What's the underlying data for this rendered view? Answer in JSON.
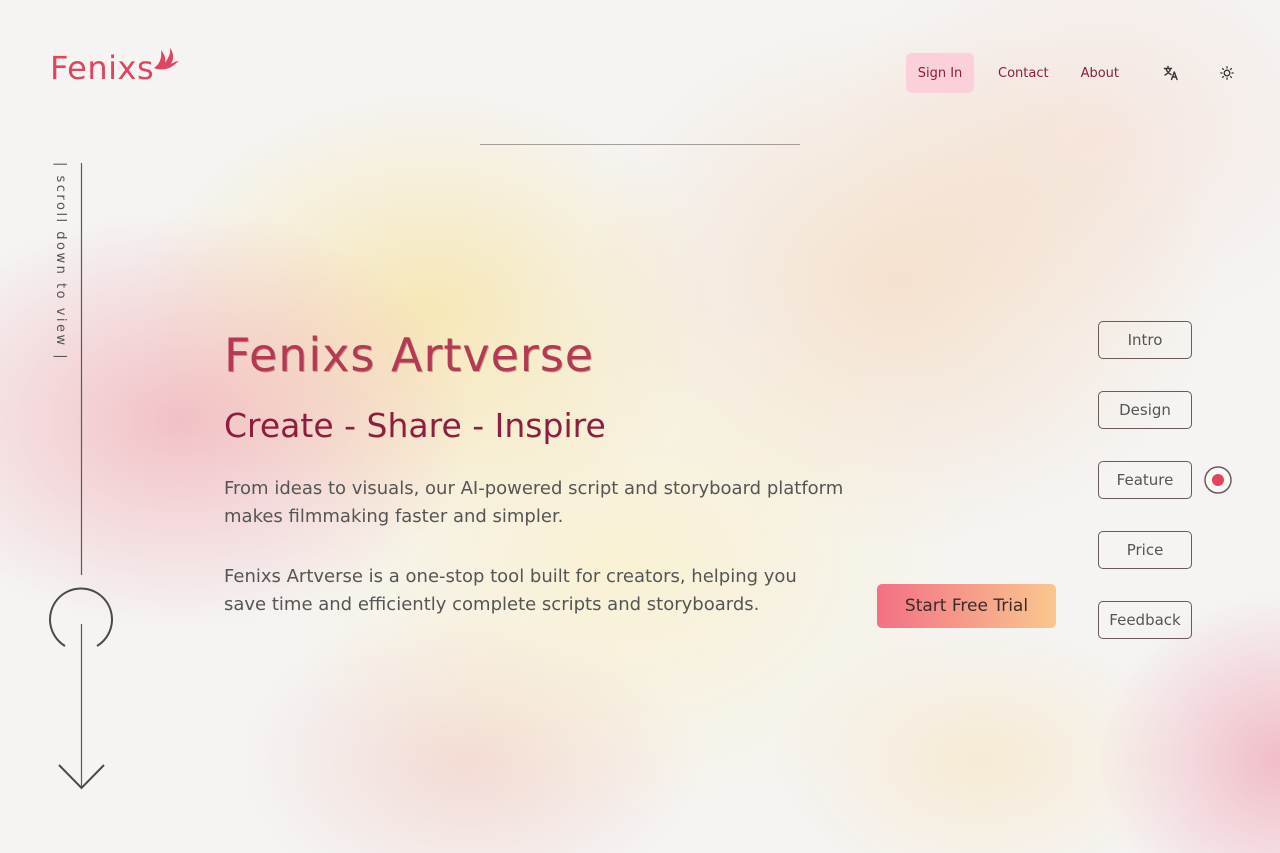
{
  "brand": {
    "name": "Fenixs",
    "color": "#e0455d",
    "mark_icon": "phoenix-flame-icon"
  },
  "header": {
    "nav": {
      "sign_in": "Sign In",
      "contact": "Contact",
      "about": "About",
      "translate_icon": "translate-icon",
      "theme_icon": "sun-icon"
    }
  },
  "scroll_hint": {
    "text": "| scroll down to view |",
    "icon": "arrow-down-icon"
  },
  "hero": {
    "title": "Fenixs Artverse",
    "tagline": "Create - Share - Inspire",
    "paragraph1": "From ideas to visuals, our AI-powered script and storyboard platform makes filmmaking faster and simpler.",
    "paragraph2": "Fenixs Artverse is a one-stop tool built for creators, helping you save time and efficiently complete scripts and storyboards.",
    "cta": "Start Free Trial"
  },
  "sections": {
    "items": [
      "Intro",
      "Design",
      "Feature",
      "Price",
      "Feedback"
    ],
    "active": "Feature"
  },
  "colors": {
    "accent": "#e0455d",
    "title": "#b23a52",
    "tagline": "#8c1f40",
    "signin_bg": "#fbd0da",
    "cta_gradient_start": "#f37085",
    "cta_gradient_end": "#f9c78e"
  }
}
